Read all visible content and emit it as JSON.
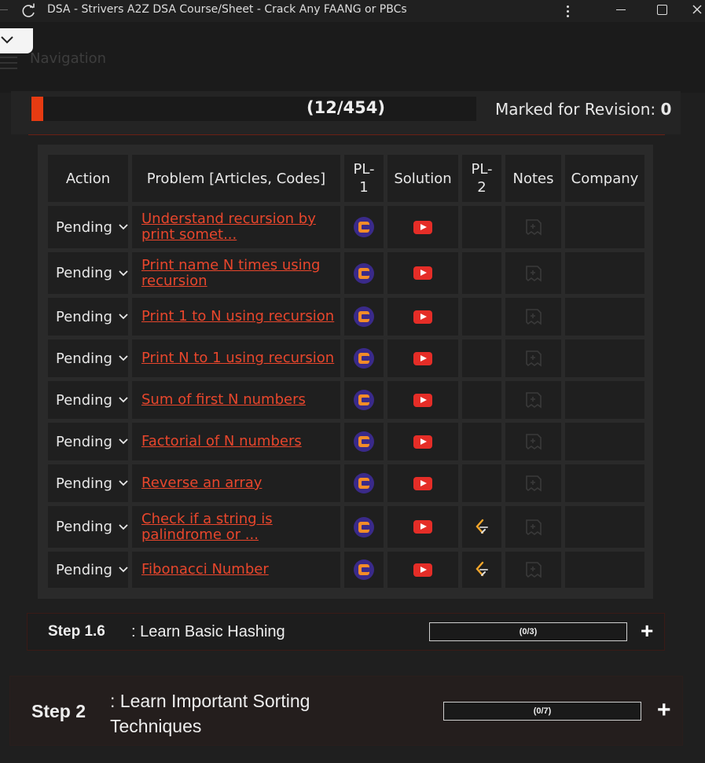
{
  "window": {
    "title": "DSA - Strivers A2Z DSA Course/Sheet - Crack Any FAANG or PBCs"
  },
  "nav": {
    "label": "Navigation"
  },
  "progress": {
    "count": "(12/454)",
    "revision_label": "Marked for Revision: ",
    "revision_count": "0",
    "fraction": 0.026
  },
  "table": {
    "headers": {
      "action": "Action",
      "problem": "Problem [Articles, Codes]",
      "pl1": "PL-1",
      "solution": "Solution",
      "pl2": "PL-2",
      "notes": "Notes",
      "company": "Company"
    },
    "rows": [
      {
        "status": "Pending",
        "problem": "Understand recursion by print somet...",
        "pl1_icon": "codingninjas-icon",
        "solution_icon": "youtube-icon",
        "pl2_icon": ""
      },
      {
        "status": "Pending",
        "problem": "Print name N times using recursion",
        "pl1_icon": "codingninjas-icon",
        "solution_icon": "youtube-icon",
        "pl2_icon": ""
      },
      {
        "status": "Pending",
        "problem": "Print 1 to N using recursion",
        "pl1_icon": "codingninjas-icon",
        "solution_icon": "youtube-icon",
        "pl2_icon": ""
      },
      {
        "status": "Pending",
        "problem": "Print N to 1 using recursion",
        "pl1_icon": "codingninjas-icon",
        "solution_icon": "youtube-icon",
        "pl2_icon": ""
      },
      {
        "status": "Pending",
        "problem": "Sum of first N numbers",
        "pl1_icon": "codingninjas-icon",
        "solution_icon": "youtube-icon",
        "pl2_icon": ""
      },
      {
        "status": "Pending",
        "problem": "Factorial of N numbers",
        "pl1_icon": "codingninjas-icon",
        "solution_icon": "youtube-icon",
        "pl2_icon": ""
      },
      {
        "status": "Pending",
        "problem": "Reverse an array",
        "pl1_icon": "codingninjas-icon",
        "solution_icon": "youtube-icon",
        "pl2_icon": ""
      },
      {
        "status": "Pending",
        "problem": "Check if a string is palindrome or ...",
        "pl1_icon": "codingninjas-icon",
        "solution_icon": "youtube-icon",
        "pl2_icon": "leetcode-icon"
      },
      {
        "status": "Pending",
        "problem": "Fibonacci Number",
        "pl1_icon": "codingninjas-icon",
        "solution_icon": "youtube-icon",
        "pl2_icon": "leetcode-icon"
      }
    ]
  },
  "steps": [
    {
      "number": "Step 1.6",
      "title": ": Learn Basic Hashing",
      "progress": "(0/3)"
    },
    {
      "number": "Step 2",
      "title": ": Learn Important Sorting Techniques",
      "progress": "(0/7)"
    }
  ]
}
